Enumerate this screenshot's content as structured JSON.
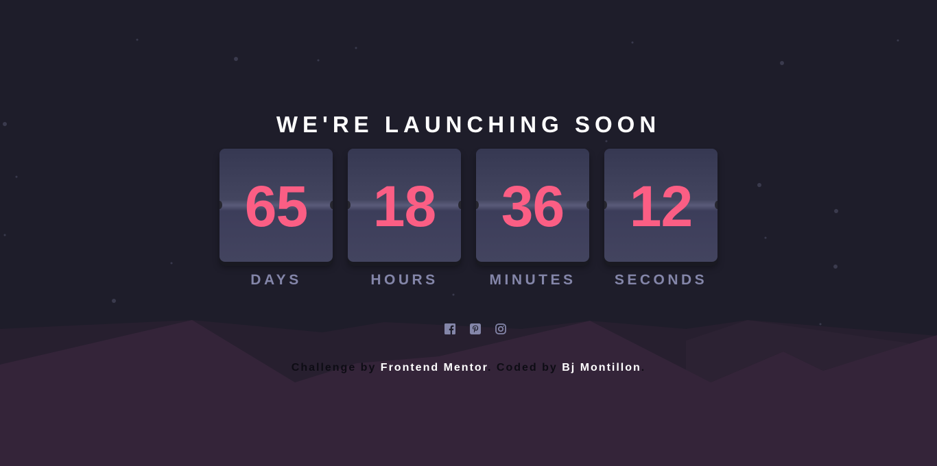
{
  "header": {
    "title": "WE'RE LAUNCHING SOON"
  },
  "countdown": [
    {
      "value": "65",
      "label": "DAYS"
    },
    {
      "value": "18",
      "label": "HOURS"
    },
    {
      "value": "36",
      "label": "MINUTES"
    },
    {
      "value": "12",
      "label": "SECONDS"
    }
  ],
  "social": [
    {
      "icon": "facebook-icon"
    },
    {
      "icon": "pinterest-icon"
    },
    {
      "icon": "instagram-icon"
    }
  ],
  "footer": {
    "challenge_prefix": "Challenge by ",
    "challenge_link": "Frontend Mentor",
    "coded_prefix": ". Coded by ",
    "coded_link": "Bj Montillon",
    "suffix": "."
  },
  "colors": {
    "background": "#1e1d2a",
    "hills": "#342439",
    "accent": "#fb5e84",
    "label": "#8486a9",
    "card": "#43445f",
    "icon": "#8486a9"
  }
}
